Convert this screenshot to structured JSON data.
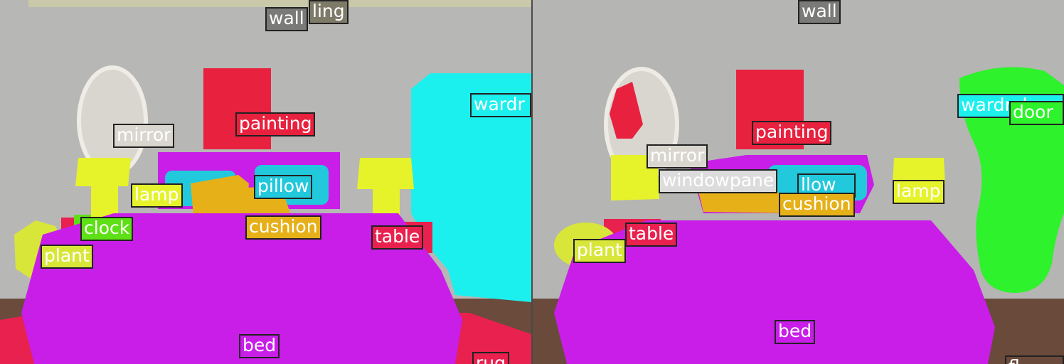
{
  "panels": {
    "left": {
      "labels": {
        "ceiling": "ling",
        "wall": "wall",
        "painting": "painting",
        "mirror": "mirror",
        "wardrobe": "wardr",
        "pillow": "pillow",
        "lamp": "lamp",
        "cushion": "cushion",
        "clock": "clock",
        "table": "table",
        "plant": "plant",
        "bed": "bed",
        "rug": "rug"
      }
    },
    "right": {
      "labels": {
        "wall": "wall",
        "wardrobe": "wardrob",
        "door": "door",
        "painting": "painting",
        "mirror": "mirror",
        "windowpane": "windowpane",
        "pillow": "llow",
        "lamp": "lamp",
        "cushion": "cushion",
        "table": "table",
        "plant": "plant",
        "bed": "bed",
        "floor": "fl"
      }
    }
  },
  "colors": {
    "wall": "#b5b5b3",
    "ceiling": "#7d7a68",
    "painting": "#e8213f",
    "mirror": "#d9d6cf",
    "wardrobe": "#1cf0ee",
    "door": "#2ef22b",
    "pillow": "#22c8db",
    "lamp": "#e6f22a",
    "cushion": "#e6b018",
    "clock": "#5ee016",
    "table": "#e8214f",
    "plant": "#d8e63a",
    "bed": "#c81ee8",
    "rug": "#e8214f",
    "windowpane": "#dcdcdc",
    "floor": "#6a4a3a"
  }
}
